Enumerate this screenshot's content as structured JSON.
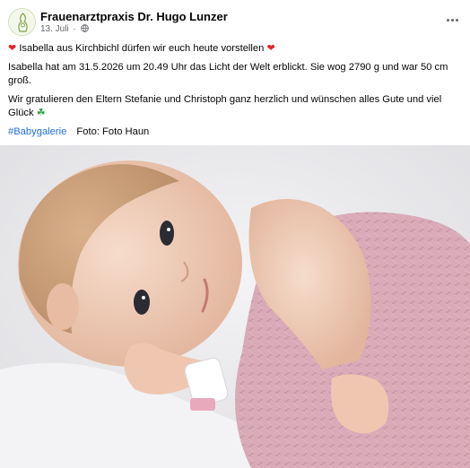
{
  "post": {
    "author": "Frauenarztpraxis Dr. Hugo Lunzer",
    "date": "13. Juli",
    "separator": "·",
    "privacy_icon": "globe-icon",
    "more_icon": "more-options-icon",
    "headline_icon": "red-heart-icon",
    "headline": "Isabella aus Kirchbichl dürfen wir euch heute vorstellen",
    "paragraph_1": "Isabella hat am 31.5.2026 um 20.49 Uhr das Licht der Welt erblickt. Sie wog 2790 g und war 50 cm groß.",
    "paragraph_2": "Wir gratulieren den Eltern Stefanie und Christoph ganz herzlich und wünschen alles Gute und viel Glück",
    "paragraph_2_icon": "four-leaf-clover-icon",
    "hashtag": "#Babygalerie",
    "photo_credit": "Foto: Foto Haun"
  },
  "colors": {
    "link": "#216fdb",
    "heart": "#e0252c",
    "clover": "#2ea043",
    "secondary_text": "#65676b",
    "blanket": "#d9aab7",
    "background": "#e9e9ec"
  }
}
